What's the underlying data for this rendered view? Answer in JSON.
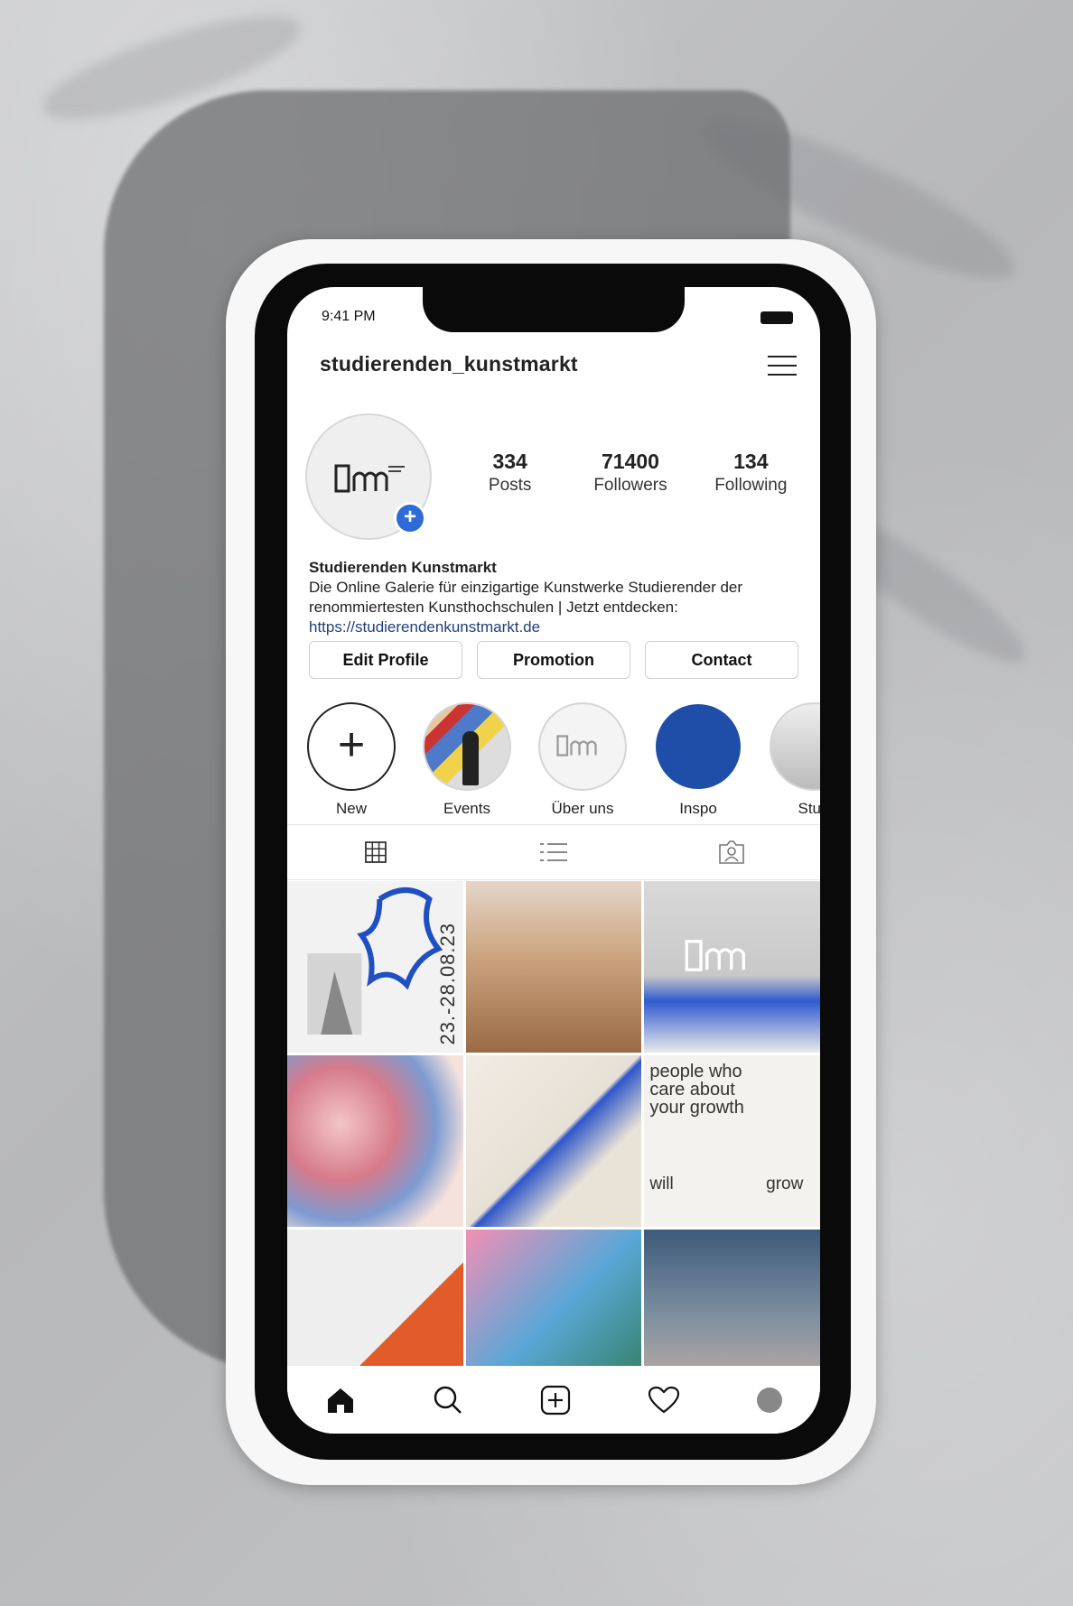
{
  "status_bar": {
    "time": "9:41 PM"
  },
  "profile": {
    "username": "studierenden_kunstmarkt",
    "stats": [
      {
        "value": "334",
        "label": "Posts"
      },
      {
        "value": "71400",
        "label": "Followers"
      },
      {
        "value": "134",
        "label": "Following"
      }
    ],
    "name": "Studierenden Kunstmarkt",
    "bio_line1": "Die Online Galerie für einzigartige Kunstwerke Studierender der",
    "bio_line2": "renommiertesten Kunsthochschulen | Jetzt entdecken:",
    "link": "https://studierendenkunstmarkt.de",
    "add_badge": "+"
  },
  "buttons": {
    "edit": "Edit Profile",
    "promotion": "Promotion",
    "contact": "Contact"
  },
  "highlights": [
    {
      "label": "New",
      "symbol": "+"
    },
    {
      "label": "Events"
    },
    {
      "label": "Über uns"
    },
    {
      "label": "Inspo"
    },
    {
      "label": "Stud"
    }
  ],
  "grid": {
    "tile1_date": "23.-28.08.23",
    "tile6_line1": "people who",
    "tile6_line2": "care about",
    "tile6_line3": "your growth",
    "tile6_will": "will",
    "tile6_grow": "grow"
  },
  "colors": {
    "accent_blue": "#2f6bd6",
    "inspo_blue": "#1e4ea7",
    "link_blue": "#1f3f7a"
  }
}
